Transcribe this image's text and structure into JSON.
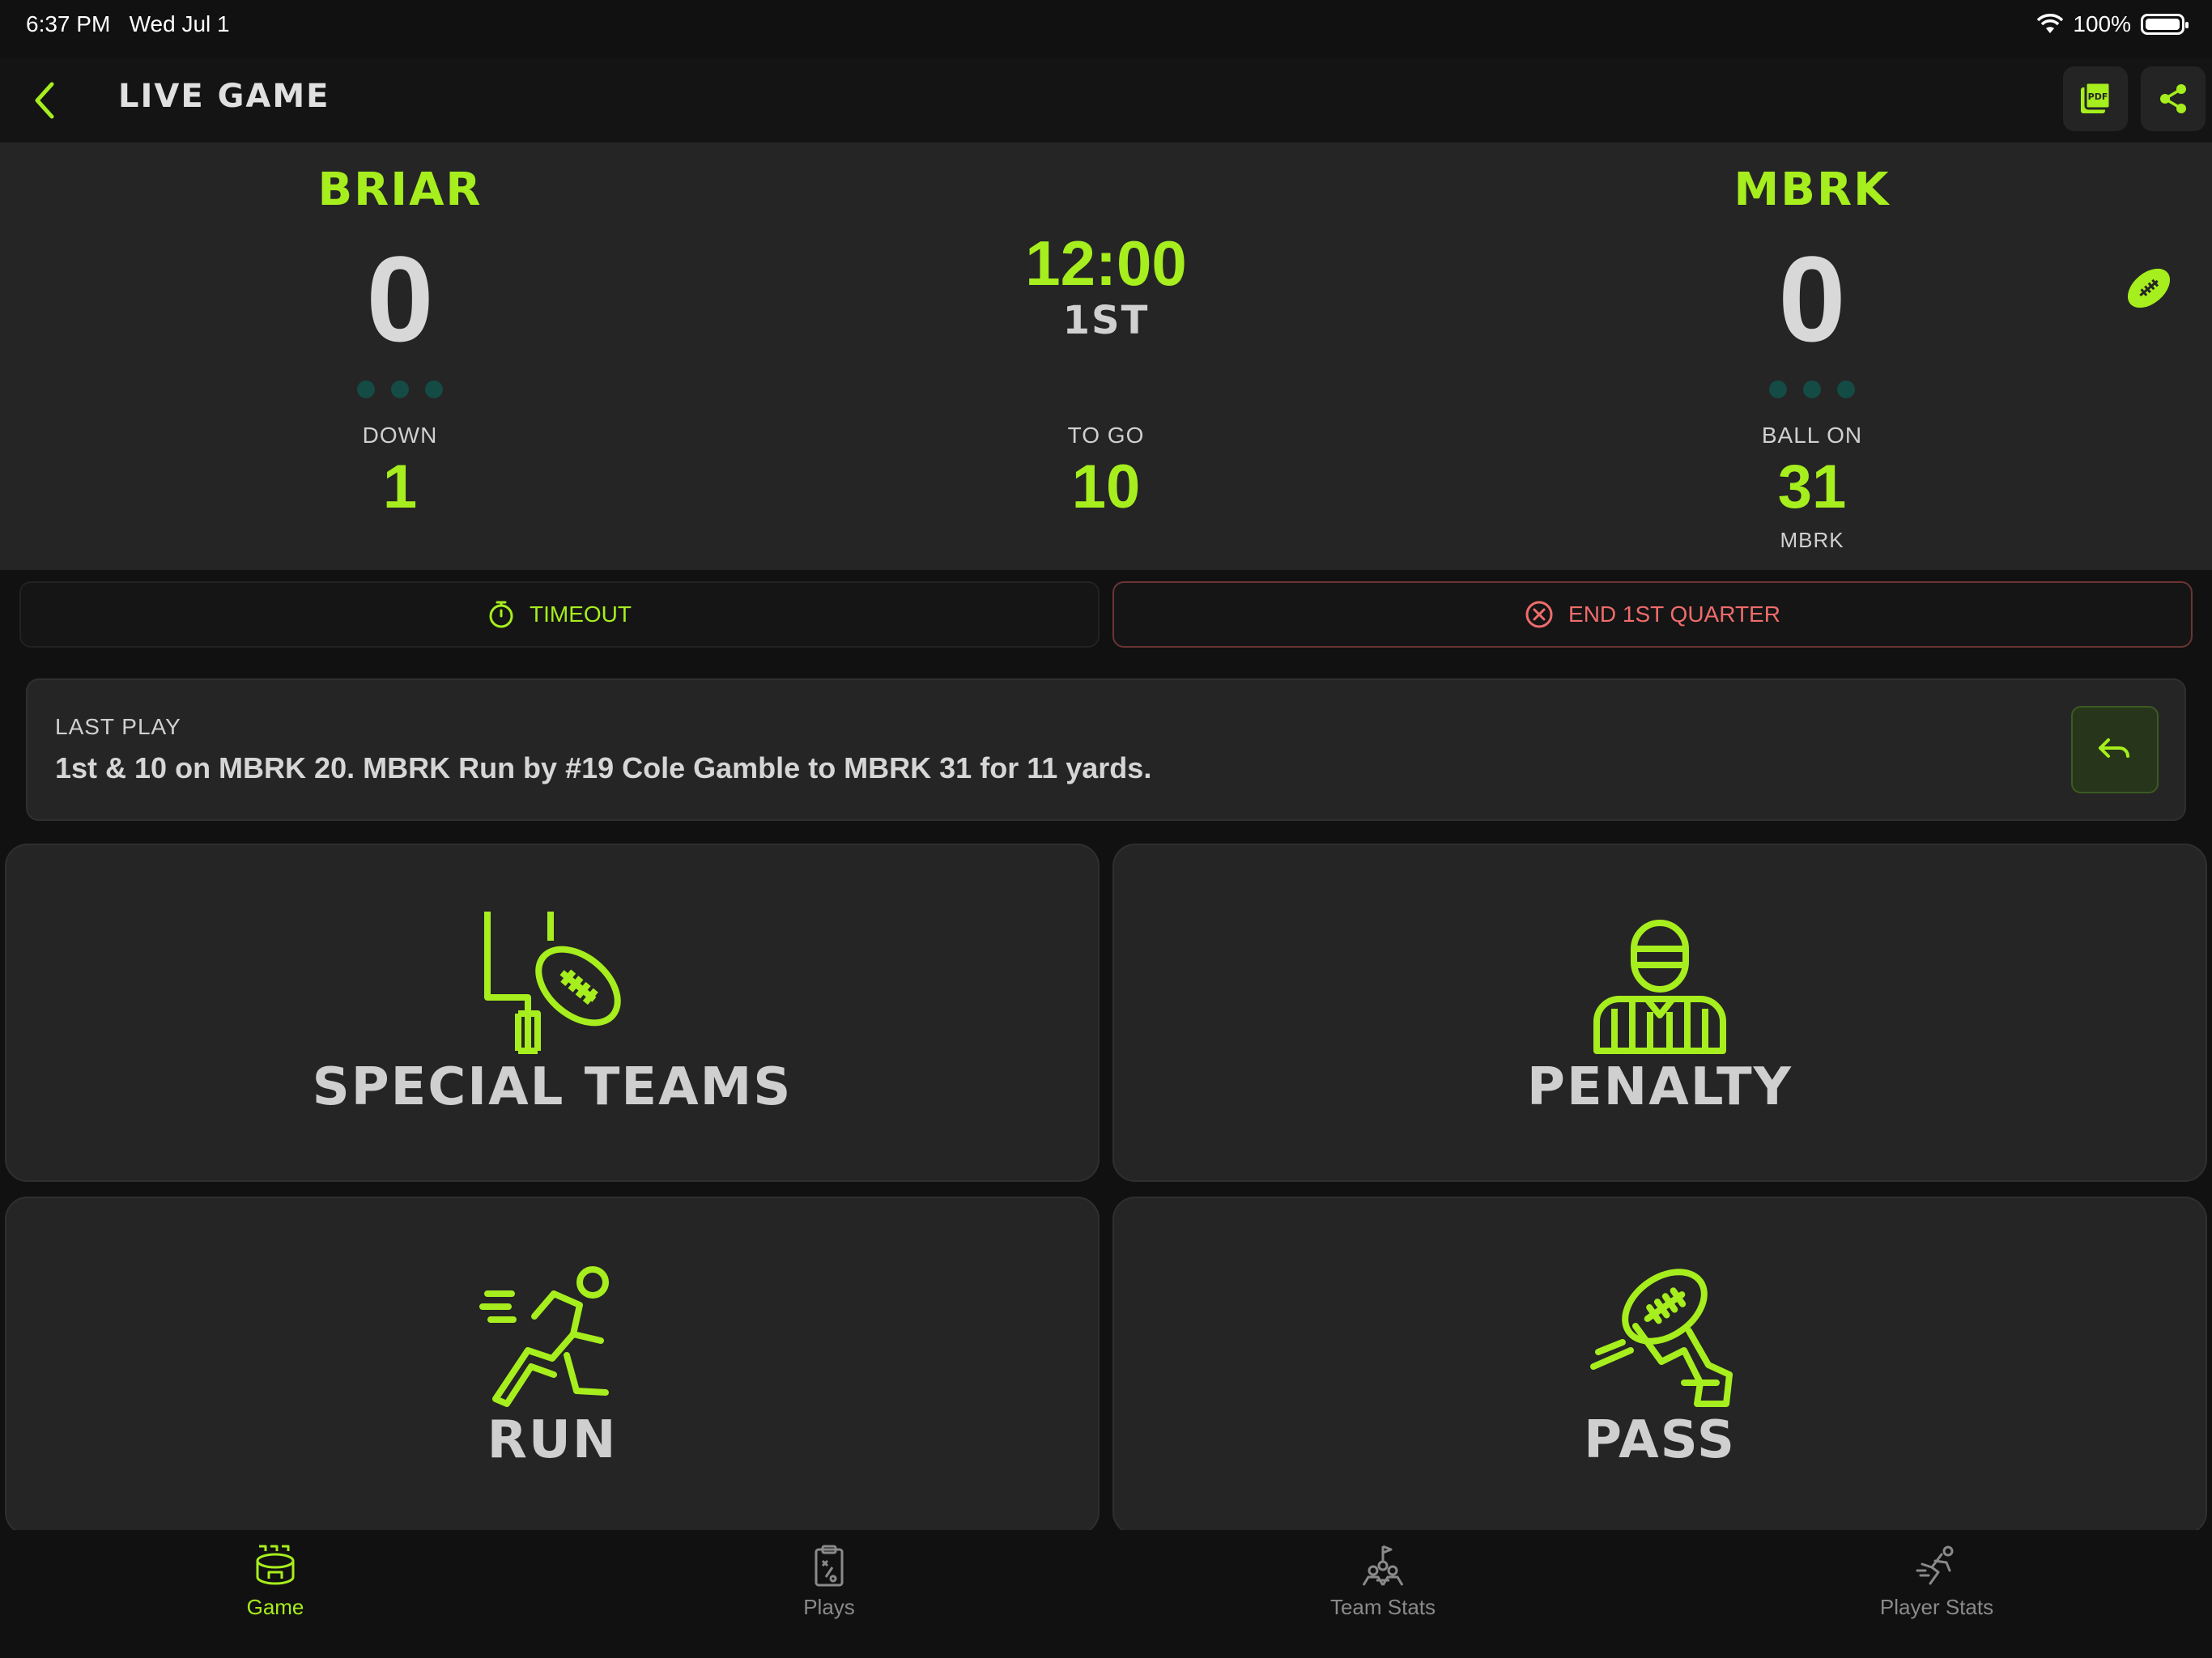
{
  "status": {
    "time": "6:37 PM",
    "date": "Wed Jul 1",
    "battery": "100%"
  },
  "header": {
    "title": "LIVE GAME",
    "pdf_icon": "pdf-icon",
    "share_icon": "share-icon"
  },
  "scoreboard": {
    "home": {
      "name": "BRIAR",
      "score": "0",
      "timeouts": 3
    },
    "away": {
      "name": "MBRK",
      "score": "0",
      "timeouts": 3
    },
    "clock": "12:00",
    "period": "1ST",
    "down_label": "DOWN",
    "down": "1",
    "togo_label": "TO GO",
    "togo": "10",
    "ball_on_label": "BALL ON",
    "ball_on": "31",
    "ball_on_side": "MBRK",
    "possession_icon": "football-icon"
  },
  "actions": {
    "timeout": "TIMEOUT",
    "end_quarter": "END 1ST QUARTER"
  },
  "last_play": {
    "label": "LAST PLAY",
    "text": "1st & 10 on MBRK 20. MBRK Run by #19 Cole Gamble to MBRK 31 for 11 yards."
  },
  "tiles": [
    {
      "label": "SPECIAL TEAMS",
      "icon": "goalpost-football-icon"
    },
    {
      "label": "PENALTY",
      "icon": "referee-icon"
    },
    {
      "label": "RUN",
      "icon": "runner-icon"
    },
    {
      "label": "PASS",
      "icon": "throwing-hand-icon"
    }
  ],
  "tabs": [
    {
      "label": "Game",
      "icon": "stadium-icon",
      "active": true
    },
    {
      "label": "Plays",
      "icon": "clipboard-icon",
      "active": false
    },
    {
      "label": "Team Stats",
      "icon": "team-flag-icon",
      "active": false
    },
    {
      "label": "Player Stats",
      "icon": "player-icon",
      "active": false
    }
  ],
  "colors": {
    "accent": "#a6ee1d",
    "danger": "#f06c6c",
    "panel": "#252525",
    "background": "#111111"
  }
}
